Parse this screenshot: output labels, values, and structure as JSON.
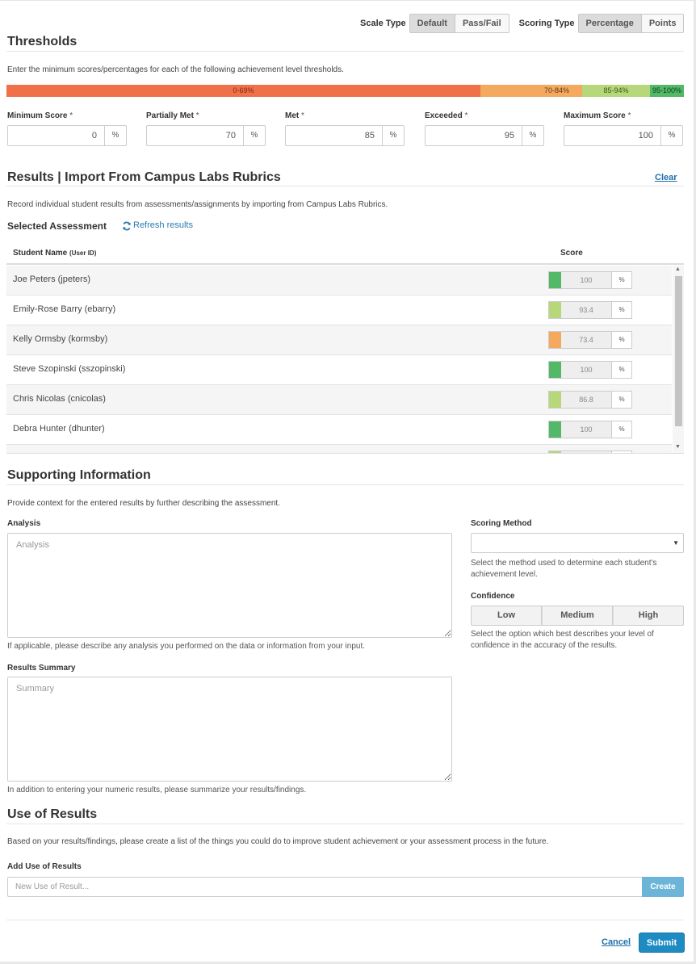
{
  "toolbar": {
    "scale_type_label": "Scale Type",
    "scale_options": [
      "Default",
      "Pass/Fail"
    ],
    "scale_selected": "Default",
    "scoring_type_label": "Scoring Type",
    "scoring_options": [
      "Percentage",
      "Points"
    ],
    "scoring_selected": "Percentage"
  },
  "thresholds": {
    "title": "Thresholds",
    "description": "Enter the minimum scores/percentages for each of the following achievement level thresholds.",
    "bar": [
      {
        "label": "0-69%",
        "color": "#f07149"
      },
      {
        "label": "70-84%",
        "color": "#f5a95f"
      },
      {
        "label": "85-94%",
        "color": "#b6d77a"
      },
      {
        "label": "95-100%",
        "color": "#53b867"
      }
    ],
    "fields": [
      {
        "label": "Minimum Score",
        "required": "*",
        "value": "0",
        "unit": "%"
      },
      {
        "label": "Partially Met",
        "required": "*",
        "value": "70",
        "unit": "%"
      },
      {
        "label": "Met",
        "required": "*",
        "value": "85",
        "unit": "%"
      },
      {
        "label": "Exceeded",
        "required": "*",
        "value": "95",
        "unit": "%"
      },
      {
        "label": "Maximum Score",
        "required": "*",
        "value": "100",
        "unit": "%"
      }
    ]
  },
  "results": {
    "title": "Results | Import From Campus Labs Rubrics",
    "clear_label": "Clear",
    "description": "Record individual student results from assessments/assignments by importing from Campus Labs Rubrics.",
    "selected_assessment_label": "Selected Assessment",
    "refresh_label": "Refresh results",
    "col_name": "Student Name",
    "col_name_sub": "(User ID)",
    "col_score": "Score",
    "rows": [
      {
        "name": "Joe Peters (jpeters)",
        "score": "100",
        "unit": "%",
        "level_color": "#53b867"
      },
      {
        "name": "Emily-Rose Barry (ebarry)",
        "score": "93.4",
        "unit": "%",
        "level_color": "#b6d77a"
      },
      {
        "name": "Kelly Ormsby (kormsby)",
        "score": "73.4",
        "unit": "%",
        "level_color": "#f5a95f"
      },
      {
        "name": "Steve Szopinski (sszopinski)",
        "score": "100",
        "unit": "%",
        "level_color": "#53b867"
      },
      {
        "name": "Chris Nicolas (cnicolas)",
        "score": "86.8",
        "unit": "%",
        "level_color": "#b6d77a"
      },
      {
        "name": "Debra Hunter (dhunter)",
        "score": "100",
        "unit": "%",
        "level_color": "#53b867"
      },
      {
        "name": "",
        "score": "",
        "unit": "",
        "level_color": "#b6d77a"
      }
    ]
  },
  "supporting": {
    "title": "Supporting Information",
    "description": "Provide context for the entered results by further describing the assessment.",
    "analysis_label": "Analysis",
    "analysis_placeholder": "Analysis",
    "analysis_help": "If applicable, please describe any analysis you performed on the data or information from your input.",
    "summary_label": "Results Summary",
    "summary_placeholder": "Summary",
    "summary_help": "In addition to entering your numeric results, please summarize your results/findings.",
    "scoring_method_label": "Scoring Method",
    "scoring_method_value": "",
    "scoring_method_help": "Select the method used to determine each student's achievement level.",
    "confidence_label": "Confidence",
    "confidence_options": [
      "Low",
      "Medium",
      "High"
    ],
    "confidence_help": "Select the option which best describes your level of confidence in the accuracy of the results."
  },
  "use_of_results": {
    "title": "Use of Results",
    "description": "Based on your results/findings, please create a list of the things you could do to improve student achievement or your assessment process in the future.",
    "add_label": "Add Use of Results",
    "input_placeholder": "New Use of Result...",
    "create_label": "Create"
  },
  "footer": {
    "cancel_label": "Cancel",
    "submit_label": "Submit"
  }
}
